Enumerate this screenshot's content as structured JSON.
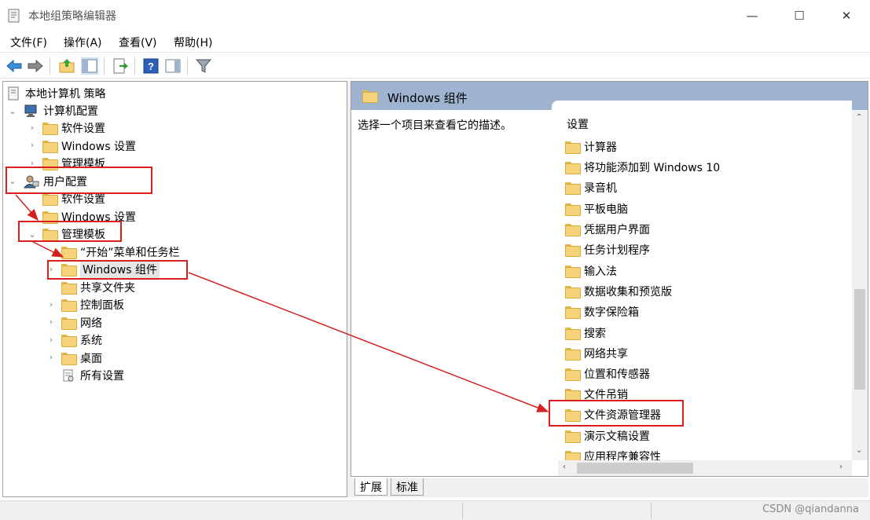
{
  "window": {
    "title": "本地组策略编辑器",
    "minimize_glyph": "—",
    "maximize_glyph": "☐",
    "close_glyph": "✕"
  },
  "menu": [
    "文件(F)",
    "操作(A)",
    "查看(V)",
    "帮助(H)"
  ],
  "toolbar_icons": [
    "back-icon",
    "forward-icon",
    "up-folder-icon",
    "show-hide-tree-icon",
    "export-list-icon",
    "help-icon",
    "show-hide-action-pane-icon",
    "filter-icon"
  ],
  "tree": {
    "root": "本地计算机 策略",
    "computer_config": "计算机配置",
    "computer_children": [
      "软件设置",
      "Windows 设置",
      "管理模板"
    ],
    "user_config": "用户配置",
    "user_children": [
      "软件设置",
      "Windows 设置",
      "管理模板"
    ],
    "admin_templates_children": [
      "“开始”菜单和任务栏",
      "Windows 组件",
      "共享文件夹",
      "控制面板",
      "网络",
      "系统",
      "桌面",
      "所有设置"
    ]
  },
  "right": {
    "header_title": "Windows 组件",
    "description": "选择一个项目来查看它的描述。",
    "column_header": "设置",
    "items": [
      "计算器",
      "将功能添加到 Windows 10",
      "录音机",
      "平板电脑",
      "凭据用户界面",
      "任务计划程序",
      "输入法",
      "数据收集和预览版",
      "数字保险箱",
      "搜索",
      "网络共享",
      "位置和传感器",
      "文件吊销",
      "文件资源管理器",
      "演示文稿设置",
      "应用程序兼容性"
    ]
  },
  "tabs": [
    "扩展",
    "标准"
  ],
  "watermark": "CSDN @qiandanna",
  "colors": {
    "header_bg": "#9db3d0",
    "annotation_red": "#d62020",
    "folder_yellow": "#f6d37a"
  }
}
